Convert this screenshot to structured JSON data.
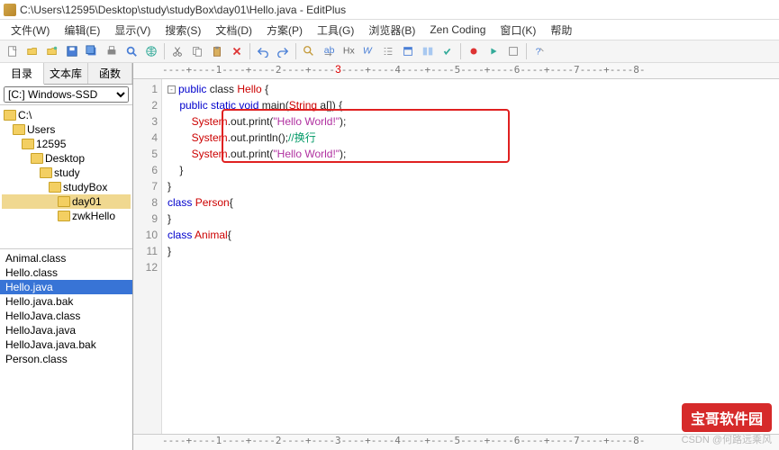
{
  "title": "C:\\Users\\12595\\Desktop\\study\\studyBox\\day01\\Hello.java - EditPlus",
  "menus": [
    "文件(W)",
    "编辑(E)",
    "显示(V)",
    "搜索(S)",
    "文档(D)",
    "方案(P)",
    "工具(G)",
    "浏览器(B)",
    "Zen Coding",
    "窗口(K)",
    "帮助"
  ],
  "sidebar": {
    "tabs": [
      "目录",
      "文本库",
      "函数"
    ],
    "drive": "[C:] Windows-SSD",
    "tree": [
      {
        "label": "C:\\",
        "indent": 0
      },
      {
        "label": "Users",
        "indent": 1
      },
      {
        "label": "12595",
        "indent": 2
      },
      {
        "label": "Desktop",
        "indent": 3
      },
      {
        "label": "study",
        "indent": 4
      },
      {
        "label": "studyBox",
        "indent": 5
      },
      {
        "label": "day01",
        "indent": 6,
        "sel": true
      },
      {
        "label": "zwkHello",
        "indent": 6
      }
    ],
    "files": [
      "Animal.class",
      "Hello.class",
      "Hello.java",
      "Hello.java.bak",
      "HelloJava.class",
      "HelloJava.java",
      "HelloJava.java.bak",
      "Person.class"
    ],
    "selected_file": "Hello.java"
  },
  "ruler": "----+----1----+----2----+----3----+----4----+----5----+----6----+----7----+----8-",
  "code": {
    "lines": [
      1,
      2,
      3,
      4,
      5,
      6,
      7,
      8,
      9,
      10,
      11,
      12
    ],
    "l1a": "public",
    "l1b": " class ",
    "l1c": "Hello",
    "l1d": " {",
    "l2a": "    public static void",
    "l2b": " main(",
    "l2c": "String",
    "l2d": " a[]) {",
    "l3a": "        System",
    "l3b": ".out.print(",
    "l3c": "\"Hello World!\"",
    "l3d": ");",
    "l4a": "        System",
    "l4b": ".out.println();",
    "l4c": "//换行",
    "l5a": "        System",
    "l5b": ".out.print(",
    "l5c": "\"Hello World!\"",
    "l5d": ");",
    "l6": "    }",
    "l7": "}",
    "l8a": "class ",
    "l8b": "Person",
    "l8c": "{",
    "l9": "}",
    "l10a": "class ",
    "l10b": "Animal",
    "l10c": "{",
    "l11": "}",
    "l12": ""
  },
  "watermark": "宝哥软件园",
  "csdn": "CSDN @何路远乘风"
}
